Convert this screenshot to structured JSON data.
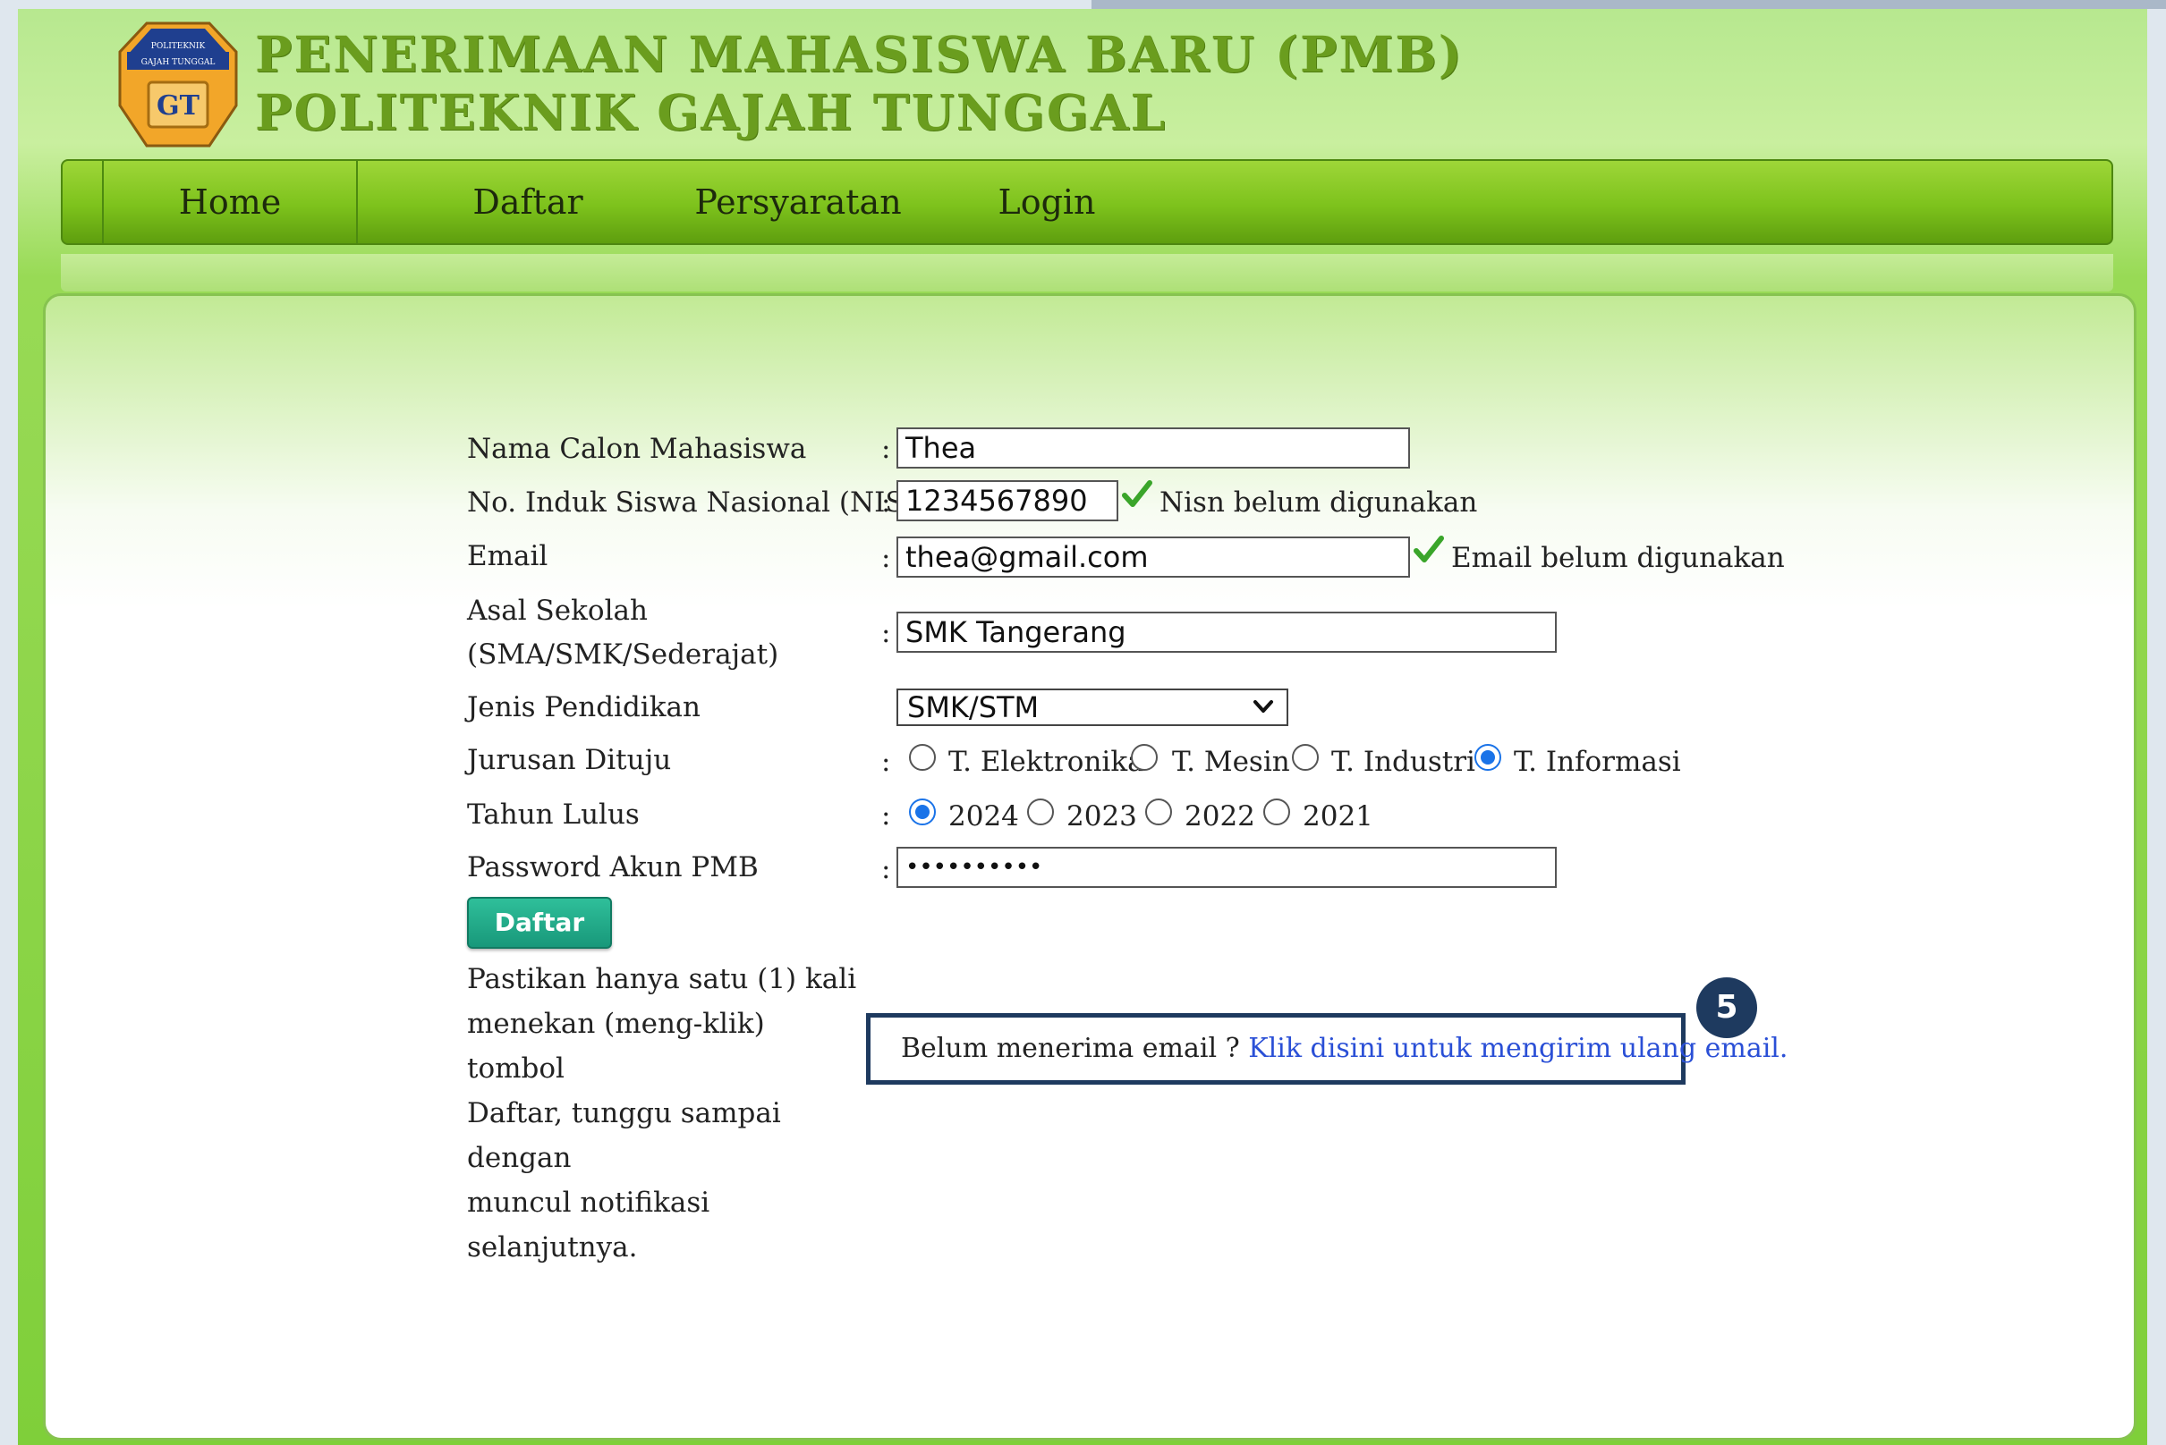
{
  "header": {
    "title_line1": "PENERIMAAN MAHASISWA BARU (PMB)",
    "title_line2": "POLITEKNIK GAJAH TUNGGAL",
    "logo_text_top": "POLITEKNIK",
    "logo_text_bottom": "GAJAH TUNGGAL",
    "logo_monogram": "GT"
  },
  "nav": {
    "items": [
      {
        "label": "Home"
      },
      {
        "label": "Daftar"
      },
      {
        "label": "Persyaratan"
      },
      {
        "label": "Login"
      }
    ]
  },
  "form": {
    "colon": ":",
    "name": {
      "label": "Nama Calon Mahasiswa",
      "value": "Thea"
    },
    "nisn": {
      "label": "No. Induk Siswa Nasional (NISN)",
      "value": "1234567890",
      "status": "Nisn belum digunakan"
    },
    "email": {
      "label": "Email",
      "value": "thea@gmail.com",
      "status": "Email belum digunakan"
    },
    "school": {
      "label_line1": "Asal Sekolah",
      "label_line2": "(SMA/SMK/Sederajat)",
      "value": "SMK Tangerang"
    },
    "education": {
      "label": "Jenis Pendidikan",
      "selected": "SMK/STM"
    },
    "major": {
      "label": "Jurusan Dituju",
      "options": [
        {
          "label": "T. Elektronika",
          "checked": false
        },
        {
          "label": "T. Mesin",
          "checked": false
        },
        {
          "label": "T. Industri",
          "checked": false
        },
        {
          "label": "T. Informasi",
          "checked": true
        }
      ]
    },
    "graduation_year": {
      "label": "Tahun Lulus",
      "options": [
        {
          "label": "2024",
          "checked": true
        },
        {
          "label": "2023",
          "checked": false
        },
        {
          "label": "2022",
          "checked": false
        },
        {
          "label": "2021",
          "checked": false
        }
      ]
    },
    "password": {
      "label": "Password Akun PMB",
      "value": "••••••••••"
    },
    "submit_label": "Daftar",
    "instruction_lines": [
      "Pastikan hanya satu (1) kali",
      "menekan (meng-klik) tombol",
      "Daftar, tunggu sampai dengan",
      "muncul notifikasi selanjutnya."
    ]
  },
  "resend": {
    "prompt": "Belum menerima email ? ",
    "link": "Klik disini untuk mengirim ulang email."
  },
  "step_badge": "5",
  "colors": {
    "nav_green": "#7dc21c",
    "title_green": "#6a9d1e",
    "button_teal": "#18987a",
    "link_blue": "#2a4fd6",
    "callout_navy": "#1e3a5f",
    "check_green": "#3aa52a",
    "radio_blue": "#1a73e8"
  },
  "icons": {
    "valid": "check-icon",
    "dropdown": "chevron-down-icon"
  }
}
